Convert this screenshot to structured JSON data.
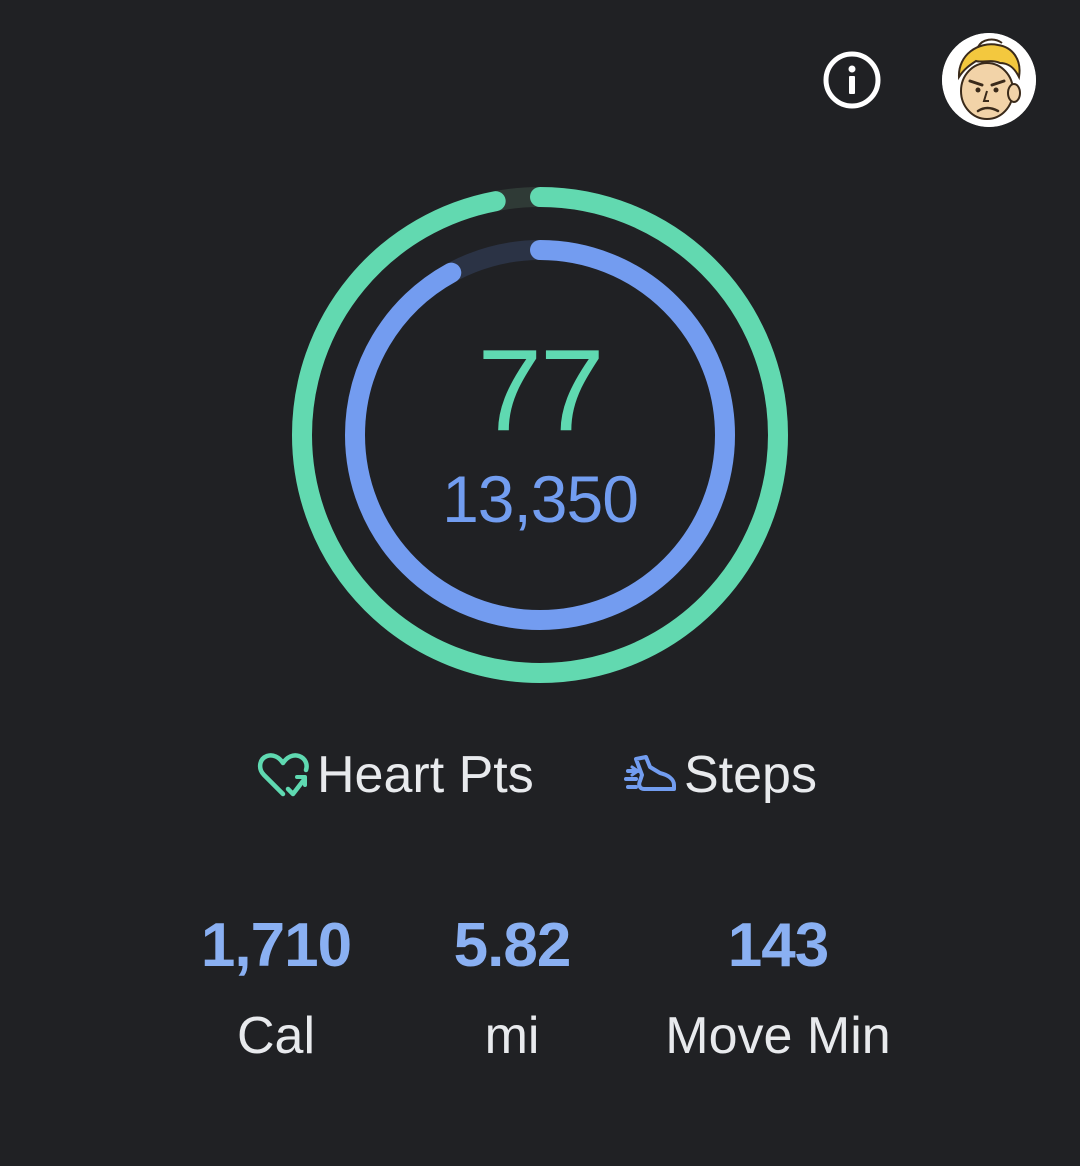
{
  "header": {
    "info_icon": "info-icon",
    "avatar_icon": "avatar"
  },
  "rings": {
    "heart_points": {
      "value": "77",
      "progress": 0.97,
      "color": "#62d9b0"
    },
    "steps": {
      "value": "13,350",
      "progress": 0.92,
      "color": "#739cf0"
    }
  },
  "legend": {
    "heart": {
      "label": "Heart Pts",
      "icon": "heart-refresh-icon",
      "color": "#5fd9b1"
    },
    "steps": {
      "label": "Steps",
      "icon": "shoe-icon",
      "color": "#729df0"
    }
  },
  "stats": {
    "calories": {
      "value": "1,710",
      "unit": "Cal"
    },
    "distance": {
      "value": "5.82",
      "unit": "mi"
    },
    "move_minutes": {
      "value": "143",
      "unit": "Move Min"
    }
  }
}
